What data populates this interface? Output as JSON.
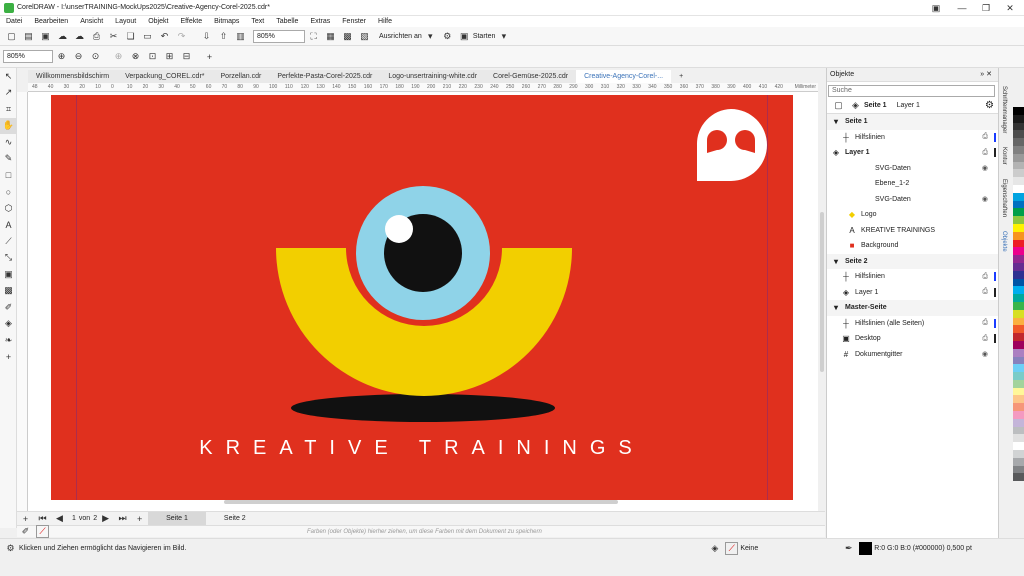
{
  "window": {
    "title": "CorelDRAW - I:\\unserTRAINING-MockUps2025\\Creative-Agency-Corel-2025.cdr*"
  },
  "menu": [
    "Datei",
    "Bearbeiten",
    "Ansicht",
    "Layout",
    "Objekt",
    "Effekte",
    "Bitmaps",
    "Text",
    "Tabelle",
    "Extras",
    "Fenster",
    "Hilfe"
  ],
  "toolbar": {
    "zoom": "805%",
    "align_label": "Ausrichten an",
    "start_label": "Starten"
  },
  "propertybar": {
    "zoom": "805%"
  },
  "tabs": [
    "Willkommensbildschirm",
    "Verpackung_COREL.cdr*",
    "Porzellan.cdr",
    "Perfekte-Pasta-Corel-2025.cdr",
    "Logo-unsertraining-white.cdr",
    "Corel-Gemüse-2025.cdr",
    "Creative-Agency-Corel-..."
  ],
  "ruler": {
    "unit": "Millimeter",
    "ticks": [
      "48",
      "40",
      "30",
      "20",
      "10",
      "0",
      "10",
      "20",
      "30",
      "40",
      "50",
      "60",
      "70",
      "80",
      "90",
      "100",
      "110",
      "120",
      "130",
      "140",
      "150",
      "160",
      "170",
      "180",
      "190",
      "200",
      "210",
      "220",
      "230",
      "240",
      "250",
      "260",
      "270",
      "280",
      "290",
      "300",
      "310",
      "320",
      "330",
      "340",
      "350",
      "360",
      "370",
      "380",
      "390",
      "400",
      "410",
      "420"
    ]
  },
  "artwork": {
    "text": "KREATIVE TRAININGS"
  },
  "pages": {
    "current": "1",
    "of_label": "von",
    "total": "2",
    "tabs": [
      "Seite 1",
      "Seite 2"
    ]
  },
  "colorbar": {
    "hint": "Farben (oder Objekte) hierher ziehen, um diese Farben mit dem Dokument zu speichern"
  },
  "status": {
    "message": "Klicken und Ziehen ermöglicht das Navigieren im Bild.",
    "fill": "Keine",
    "outline": "R:0 G:0 B:0 (#000000)  0,500 pt"
  },
  "panel": {
    "title": "Objekte",
    "search_placeholder": "Suche",
    "header_page": "Seite 1",
    "header_layer": "Layer 1",
    "rows": [
      {
        "label": "Seite 1",
        "icon": "",
        "section": true,
        "indent": 0
      },
      {
        "label": "Hilfslinien",
        "icon": "guides-icon",
        "indent": 10,
        "bar": "#1a3cff"
      },
      {
        "label": "Layer 1",
        "icon": "layer-icon",
        "indent": 0,
        "bold": true,
        "bar": "#222"
      },
      {
        "label": "SVG-Daten",
        "icon": "",
        "indent": 30,
        "eye": true
      },
      {
        "label": "Ebene_1-2",
        "icon": "",
        "indent": 30
      },
      {
        "label": "SVG-Daten",
        "icon": "",
        "indent": 30,
        "eye": true
      },
      {
        "label": "Logo",
        "icon": "logo-group-icon",
        "indent": 16
      },
      {
        "label": "KREATIVE TRAININGS",
        "icon": "text-icon",
        "indent": 16
      },
      {
        "label": "Background",
        "icon": "rectangle-icon",
        "indent": 16
      },
      {
        "label": "Seite 2",
        "icon": "",
        "section": true,
        "indent": 0
      },
      {
        "label": "Hilfslinien",
        "icon": "guides-icon",
        "indent": 10,
        "bar": "#1a3cff"
      },
      {
        "label": "Layer 1",
        "icon": "layer-icon",
        "indent": 10,
        "bar": "#222"
      },
      {
        "label": "Master-Seite",
        "icon": "",
        "section": true,
        "indent": 0
      },
      {
        "label": "Hilfslinien (alle Seiten)",
        "icon": "guides-icon",
        "indent": 10,
        "bar": "#1a3cff"
      },
      {
        "label": "Desktop",
        "icon": "desktop-icon",
        "indent": 10,
        "bar": "#222"
      },
      {
        "label": "Dokumentgitter",
        "icon": "grid-icon",
        "indent": 10,
        "eye": true
      }
    ]
  },
  "side_tabs": [
    "Schriftenmanager",
    "Kontur",
    "Eigenschaften",
    "Objekte"
  ],
  "colors": {
    "page": "#e0301e",
    "yellow": "#f2cf00",
    "iris": "#8fd3e8",
    "black": "#111111",
    "white": "#ffffff"
  },
  "palette": [
    "#000000",
    "#1a1a1a",
    "#333333",
    "#4d4d4d",
    "#666666",
    "#808080",
    "#999999",
    "#b3b3b3",
    "#cccccc",
    "#e6e6e6",
    "#ffffff",
    "#00a3e0",
    "#0070c0",
    "#009e49",
    "#8dc63f",
    "#fff200",
    "#f7941d",
    "#ed1c24",
    "#ec008c",
    "#92278f",
    "#662d91",
    "#2e3192",
    "#0054a6",
    "#00aeef",
    "#00a99d",
    "#39b54a",
    "#d7df23",
    "#fbb040",
    "#f15a29",
    "#c1272d",
    "#9e005d",
    "#ab7fc1",
    "#8781bd",
    "#6dcff6",
    "#7accc8",
    "#a3d39c",
    "#fff799",
    "#fdc689",
    "#f69679",
    "#f49ac1",
    "#c4b5d9",
    "#bcbec0",
    "#e0e0e0",
    "#ffffff",
    "#d1d3d4",
    "#a7a9ac",
    "#808285",
    "#58595b"
  ]
}
